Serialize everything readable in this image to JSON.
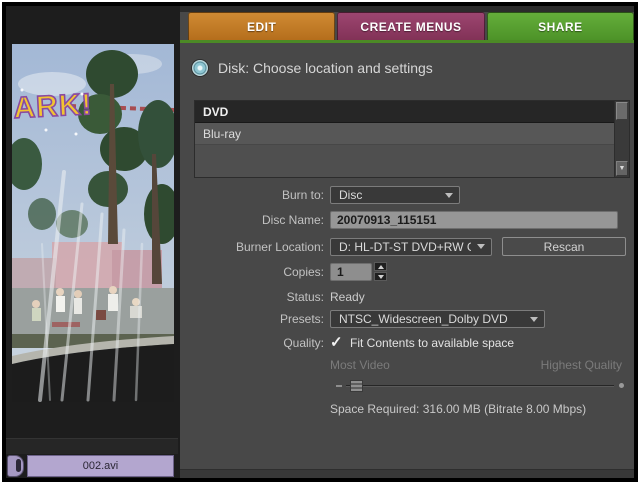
{
  "tabs": {
    "edit": "EDIT",
    "create_menus": "CREATE MENUS",
    "share": "SHARE",
    "active": "SHARE"
  },
  "header": {
    "title": "Disk: Choose location and settings"
  },
  "location_list": {
    "items": [
      {
        "label": "DVD",
        "selected": true
      },
      {
        "label": "Blu-ray",
        "selected": false
      }
    ]
  },
  "form": {
    "burn_to_label": "Burn to:",
    "burn_to_value": "Disc",
    "disc_name_label": "Disc Name:",
    "disc_name_value": "20070913_115151",
    "burner_location_label": "Burner Location:",
    "burner_location_value": "D: HL-DT-ST DVD+RW GC",
    "rescan_label": "Rescan",
    "copies_label": "Copies:",
    "copies_value": "1",
    "status_label": "Status:",
    "status_value": "Ready",
    "presets_label": "Presets:",
    "presets_value": "NTSC_Widescreen_Dolby DVD",
    "quality_label": "Quality:",
    "quality_checkbox_label": "Fit Contents to available space",
    "quality_checked": true,
    "slider_left_label": "Most Video",
    "slider_right_label": "Highest Quality",
    "slider_position_pct": 5,
    "space_required": "Space Required: 316.00 MB (Bitrate 8.00 Mbps)"
  },
  "preview": {
    "overlay_text": "ARK!"
  },
  "timeline": {
    "clip_label": "002.avi"
  },
  "colors": {
    "tab_edit": "#c47b26",
    "tab_create_menus": "#8f3a64",
    "tab_share": "#57a22f",
    "tab_underline": "#4c8a26",
    "panel_bg": "#484848",
    "selected_row_bg": "#262626",
    "clip_fill": "#b3a6cf"
  }
}
